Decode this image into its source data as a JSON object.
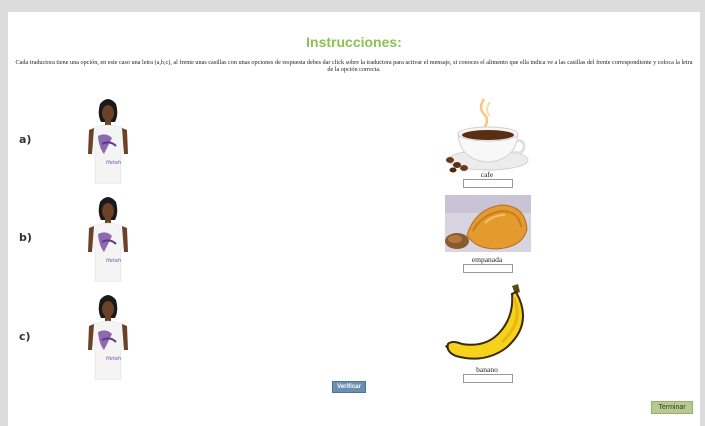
{
  "title": "Instrucciones:",
  "instructions": "Cada traductora tiene una opción, en este caso una letra (a,b,c), al frente unas casillas con unas opciones de respuesta debes dar click sobre la traductora para activar el mensaje, si conoces el alimento que ella indica ve a las casillas del frente correspondiente y coloca la letra de la opción correcta.",
  "rows": [
    {
      "letter": "a)",
      "food_label": "cafe",
      "answer_value": ""
    },
    {
      "letter": "b)",
      "food_label": "empanada",
      "answer_value": ""
    },
    {
      "letter": "c)",
      "food_label": "banano",
      "answer_value": ""
    }
  ],
  "buttons": {
    "verify": "Verificar",
    "finish": "Terminar"
  },
  "colors": {
    "title": "#8cc152",
    "verify_button": "#6a8fb3",
    "finish_button": "#b5cc8e",
    "frame": "#dcdcdc",
    "shirt_logo": "#7b4fa3"
  }
}
